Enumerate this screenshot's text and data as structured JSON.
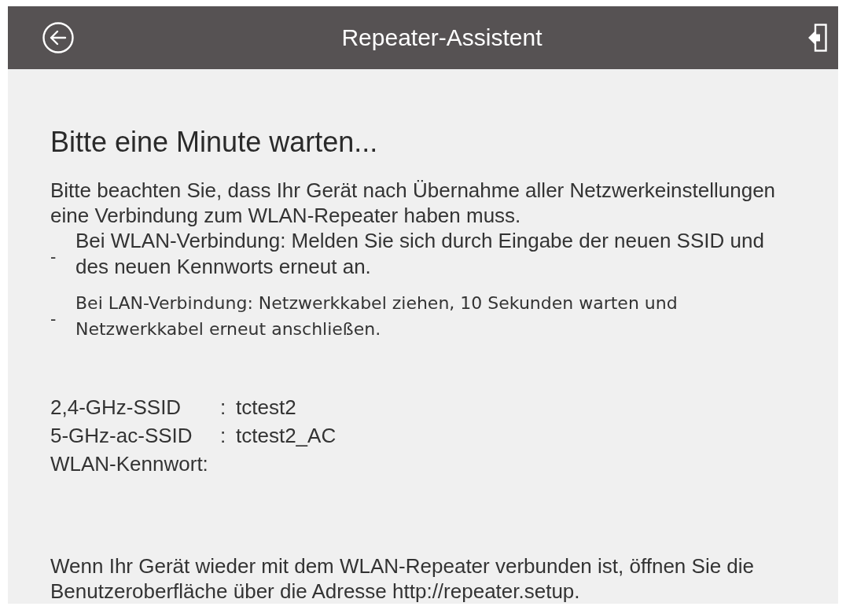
{
  "header": {
    "title": "Repeater-Assistent"
  },
  "heading": "Bitte eine Minute warten...",
  "intro": "Bitte beachten Sie, dass Ihr Gerät nach Übernahme aller Netzwerkeinstellungen eine Verbindung zum WLAN-Repeater haben muss.",
  "steps": [
    {
      "marker": "-",
      "text": "Bei WLAN-Verbindung: Melden Sie sich durch Eingabe der neuen SSID und des neuen Kennworts erneut an."
    },
    {
      "marker": "-",
      "text": "Bei LAN-Verbindung: Netzwerkkabel ziehen, 10 Sekunden warten und Netzwerkkabel erneut anschließen."
    }
  ],
  "fields": [
    {
      "label": "2,4-GHz-SSID",
      "separator": ":",
      "value": "tctest2"
    },
    {
      "label": "5-GHz-ac-SSID",
      "separator": ":",
      "value": "tctest2_AC"
    },
    {
      "label": "WLAN-Kennwort:"
    }
  ],
  "footer": "Wenn Ihr Gerät wieder mit dem WLAN-Repeater verbunden ist, öffnen Sie die Benutzeroberfläche über die Adresse http://repeater.setup."
}
